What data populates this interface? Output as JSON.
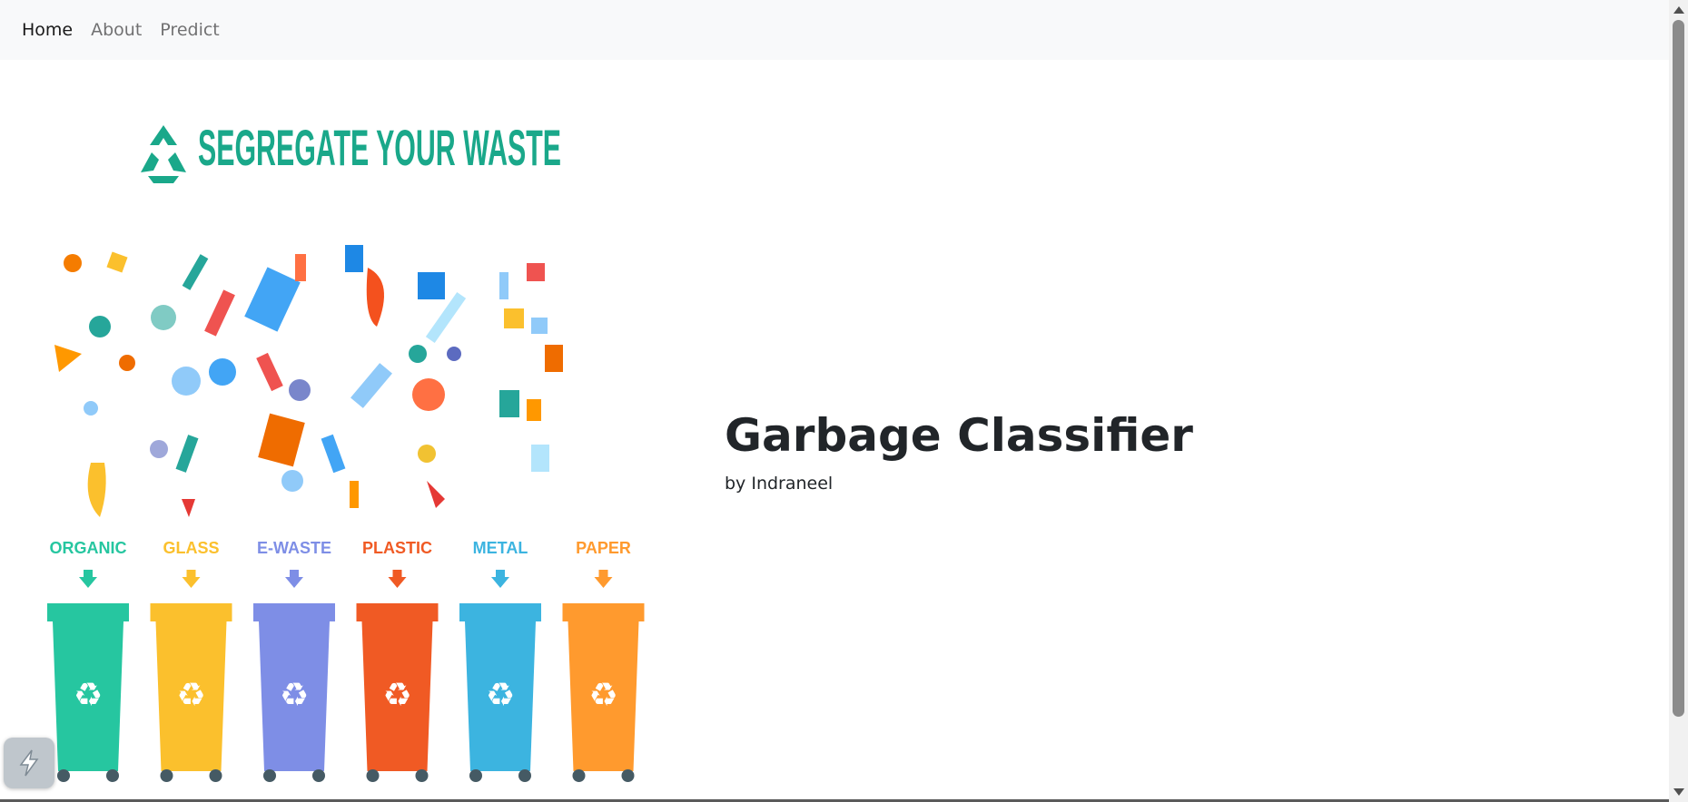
{
  "nav": {
    "items": [
      {
        "label": "Home",
        "active": true
      },
      {
        "label": "About",
        "active": false
      },
      {
        "label": "Predict",
        "active": false
      }
    ]
  },
  "image": {
    "heading": "SEGREGATE YOUR WASTE",
    "bins": [
      {
        "label": "ORGANIC",
        "color": "#26c6a0"
      },
      {
        "label": "GLASS",
        "color": "#fbc02d"
      },
      {
        "label": "E-WASTE",
        "color": "#7e8ee6"
      },
      {
        "label": "PLASTIC",
        "color": "#f05a24"
      },
      {
        "label": "METAL",
        "color": "#3cb4e0"
      },
      {
        "label": "PAPER",
        "color": "#ff9a2e"
      }
    ],
    "accent": "#1aa88a"
  },
  "hero": {
    "title": "Garbage Classifier",
    "byline": "by Indraneel"
  }
}
